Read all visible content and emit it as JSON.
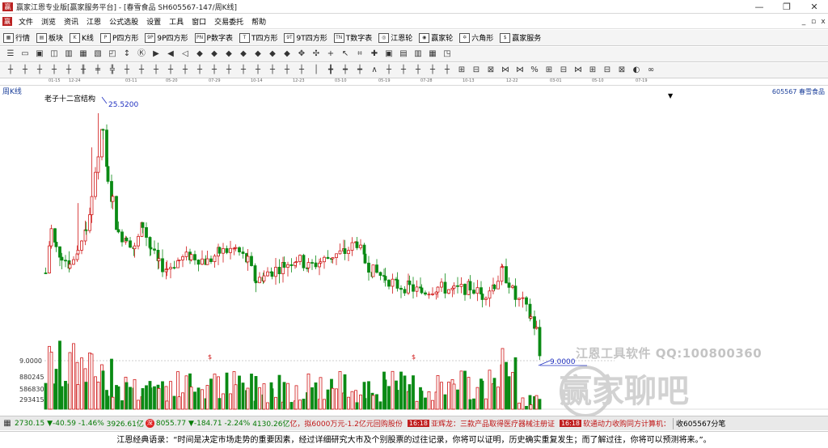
{
  "window": {
    "title": "赢家江恩专业版[赢家服务平台] - [春雪食品  SH605567-147/周K线]",
    "minimize": "—",
    "restore": "❐",
    "close": "✕"
  },
  "menu": {
    "logo": "赢",
    "items": [
      "文件",
      "浏览",
      "资讯",
      "江恩",
      "公式选股",
      "设置",
      "工具",
      "窗口",
      "交易委托",
      "帮助"
    ],
    "mdi": [
      "_",
      "▫",
      "x"
    ]
  },
  "toolbar1": [
    {
      "icon": "grid-icon",
      "glyph": "▦",
      "label": "行情"
    },
    {
      "icon": "blocks-icon",
      "glyph": "▤",
      "label": "板块"
    },
    {
      "icon": "kline-icon",
      "glyph": "K",
      "label": "K线"
    },
    {
      "icon": "p-square-icon",
      "glyph": "P",
      "label": "P四方形"
    },
    {
      "icon": "9p-square-icon",
      "glyph": "9P",
      "label": "9P四方形"
    },
    {
      "icon": "p-number-icon",
      "glyph": "PN",
      "label": "P数字表"
    },
    {
      "icon": "t-square-icon",
      "glyph": "T",
      "label": "T四方形"
    },
    {
      "icon": "9t-square-icon",
      "glyph": "9T",
      "label": "9T四方形"
    },
    {
      "icon": "t-number-icon",
      "glyph": "TN",
      "label": "T数字表"
    },
    {
      "icon": "gann-wheel-icon",
      "glyph": "◎",
      "label": "江恩轮"
    },
    {
      "icon": "winner-wheel-icon",
      "glyph": "◉",
      "label": "赢家轮"
    },
    {
      "icon": "hexagon-icon",
      "glyph": "✡",
      "label": "六角形"
    },
    {
      "icon": "dollar-icon",
      "glyph": "$",
      "label": "赢家服务"
    }
  ],
  "dates": [
    "01-15",
    "12-24",
    "03-11",
    "05-20",
    "07-29",
    "10-14",
    "12-23",
    "03-10",
    "05-19",
    "07-28",
    "10-13",
    "12-22",
    "03-01",
    "05-10",
    "07-19"
  ],
  "chart": {
    "period": "周K线",
    "indicator": "老子十二宫结构",
    "symbol": "605567  春雪食品",
    "high_label": "25.5200",
    "low_label": "9.0000",
    "axis_price": "9.0000",
    "vol_ticks": [
      "880245",
      "586830",
      "293415"
    ],
    "colors": {
      "up": "#d01818",
      "down": "#0a8a14",
      "label": "#2030c0"
    }
  },
  "watermark": {
    "line1": "江恩工具软件  QQ:100800360",
    "line2": "赢家聊吧"
  },
  "status": {
    "sh_index": "2730.15",
    "sh_change": "▼-40.59",
    "sh_pct": "-1.46%",
    "sh_amount": "3926.61亿",
    "sz_index": "8055.77",
    "sz_change": "▼-184.71",
    "sz_pct": "-2.24%",
    "sz_amount": "4130.26亿",
    "news": [
      {
        "tag": "",
        "text": "亿，拟6000万元-1.2亿元回购股份"
      },
      {
        "tag": "16:18",
        "text": "亚辉龙：三款产品取得医疗器械注册证"
      },
      {
        "tag": "16:18",
        "text": "软通动力收购同方计算机："
      }
    ],
    "right_text": "收605567分笔"
  },
  "footer": "江恩经典语录：“时间是决定市场走势的重要因素，经过详细研究大市及个别股票的过往记录，你将可以证明，历史确实重复发生；而了解过往，你将可以预测将来。”。"
}
